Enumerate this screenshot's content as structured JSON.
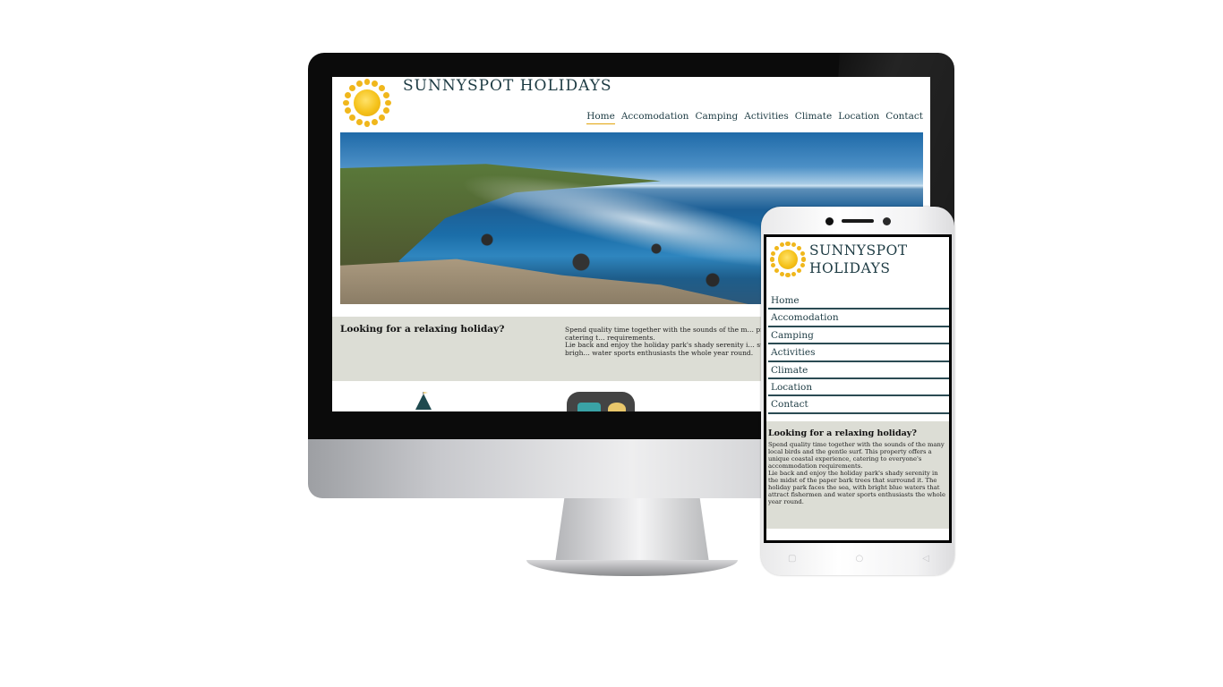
{
  "site": {
    "title": "SUNNYSPOT HOLIDAYS",
    "mobile_title_line1": "SUNNYSPOT",
    "mobile_title_line2": "HOLIDAYS"
  },
  "nav": {
    "active": "Home",
    "items": [
      "Home",
      "Accomodation",
      "Camping",
      "Activities",
      "Climate",
      "Location",
      "Contact"
    ]
  },
  "intro": {
    "heading": "Looking for a relaxing holiday?",
    "desktop_paragraph_1": "Spend quality time together with the sounds of the m… property offers a unique coastal experience, catering t… requirements.",
    "desktop_paragraph_2": "Lie back and enjoy the holiday park's shady serenity i… surround it. The holiday park faces the sea, with brigh… water sports enthusiasts the whole year round.",
    "mobile_paragraph_1": "Spend quality time together with the sounds of the many local birds and the gentle surf. This property offers a unique coastal experience, catering to everyone's accommodation requirements.",
    "mobile_paragraph_2": "Lie back and enjoy the holiday park's shady serenity in the midst of the paper bark trees that surround it. The holiday park faces the sea, with bright blue waters that attract fishermen and water sports enthusiasts the whole year round."
  },
  "icons": {
    "logo": "sun-icon",
    "feature_1": "tree-icon",
    "feature_2": "caravan-icon",
    "phone_nav": [
      "square-icon",
      "circle-icon",
      "back-triangle-icon"
    ],
    "phone_nav_glyphs": [
      "▢",
      "○",
      "◁"
    ]
  },
  "colors": {
    "heading_text": "#1d3b43",
    "accent_sun": "#f5c21a",
    "intro_band": "#dcddd5"
  }
}
